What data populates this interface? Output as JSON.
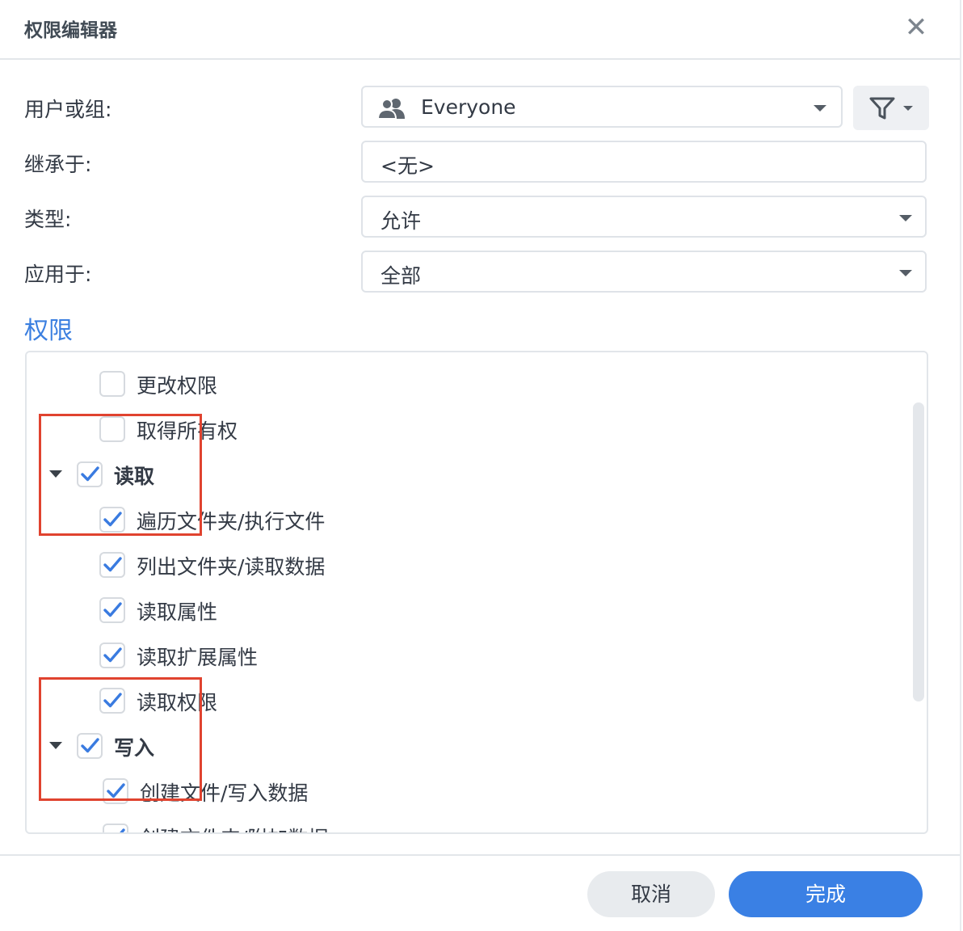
{
  "dialog": {
    "title": "权限编辑器",
    "close_glyph": "✕"
  },
  "form": {
    "user_label": "用户或组:",
    "user_value": "Everyone",
    "inherit_label": "继承于:",
    "inherit_value": "<无>",
    "type_label": "类型:",
    "type_value": "允许",
    "apply_label": "应用于:",
    "apply_value": "全部"
  },
  "permissions": {
    "section_title": "权限",
    "items": [
      {
        "label": "更改权限",
        "checked": false,
        "group": false
      },
      {
        "label": "取得所有权",
        "checked": false,
        "group": false
      },
      {
        "label": "读取",
        "checked": true,
        "group": true
      },
      {
        "label": "遍历文件夹/执行文件",
        "checked": true,
        "group": false
      },
      {
        "label": "列出文件夹/读取数据",
        "checked": true,
        "group": false
      },
      {
        "label": "读取属性",
        "checked": true,
        "group": false
      },
      {
        "label": "读取扩展属性",
        "checked": true,
        "group": false
      },
      {
        "label": "读取权限",
        "checked": true,
        "group": false
      },
      {
        "label": "写入",
        "checked": true,
        "group": true
      },
      {
        "label": "创建文件/写入数据",
        "checked": true,
        "group": false
      },
      {
        "label": "创建文件夹/附加数据",
        "checked": true,
        "group": false
      }
    ]
  },
  "footer": {
    "cancel_label": "取消",
    "done_label": "完成"
  },
  "colors": {
    "accent": "#3a80e4",
    "highlight": "#e0432f",
    "check": "#3a7be0"
  },
  "icons": {
    "user": "users-icon",
    "filter": "filter-icon",
    "dropdown": "chevron-down-icon",
    "close": "close-icon"
  }
}
